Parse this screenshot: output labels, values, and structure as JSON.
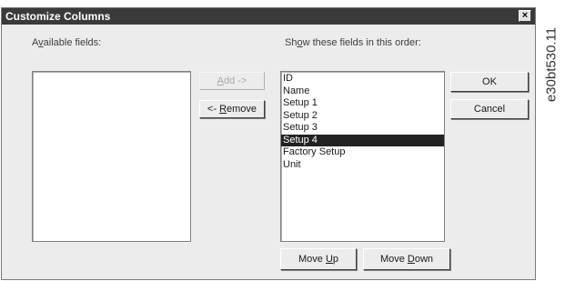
{
  "dialog": {
    "title": "Customize Columns",
    "close_glyph": "×"
  },
  "available": {
    "label_pre": "A",
    "label_u": "v",
    "label_post": "ailable fields:",
    "items": []
  },
  "shown": {
    "label_pre": "Sh",
    "label_u": "o",
    "label_post": "w these fields in this order:",
    "items": [
      "ID",
      "Name",
      "Setup 1",
      "Setup 2",
      "Setup 3",
      "Setup 4",
      "Factory Setup",
      "Unit"
    ],
    "selected_index": 5
  },
  "buttons": {
    "add_u": "A",
    "add_rest": "dd ->",
    "add_enabled": false,
    "remove_pre": "<- ",
    "remove_u": "R",
    "remove_rest": "emove",
    "ok": "OK",
    "cancel": "Cancel",
    "move_up_pre": "Move ",
    "move_up_u": "U",
    "move_up_rest": "p",
    "move_down_pre": "Move ",
    "move_down_u": "D",
    "move_down_rest": "own"
  },
  "figure_id": "e30bt530.11"
}
